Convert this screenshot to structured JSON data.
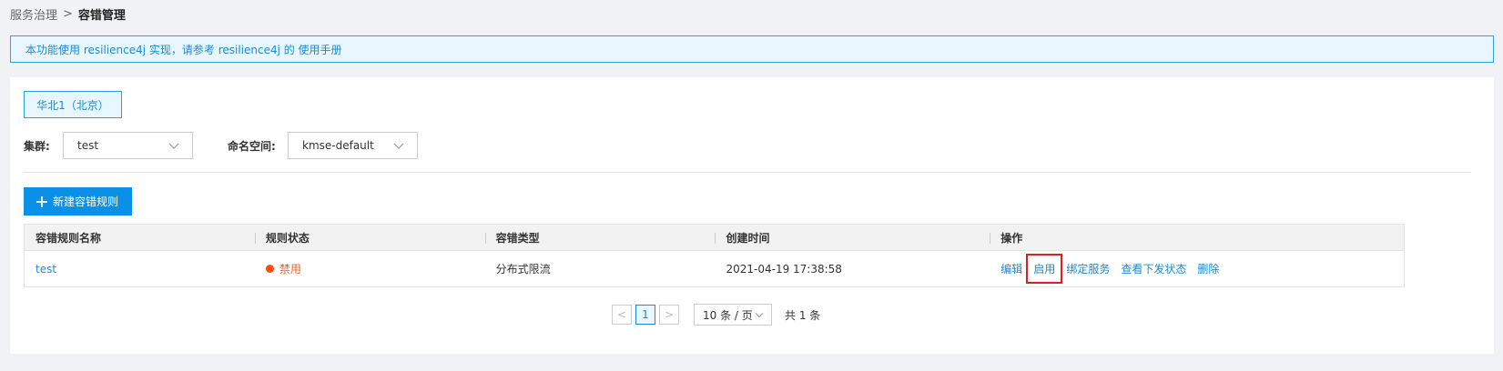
{
  "breadcrumb": {
    "parent": "服务治理",
    "separator": ">",
    "current": "容错管理"
  },
  "notice": {
    "text": "本功能使用 resilience4j 实现，请参考 resilience4j 的 使用手册"
  },
  "region": {
    "label": "华北1（北京）"
  },
  "filters": {
    "cluster_label": "集群:",
    "cluster_value": "test",
    "namespace_label": "命名空间:",
    "namespace_value": "kmse-default"
  },
  "toolbar": {
    "new_rule_label": "新建容错规则"
  },
  "table": {
    "columns": [
      "容错规则名称",
      "规则状态",
      "容错类型",
      "创建时间",
      "操作"
    ],
    "rows": [
      {
        "name": "test",
        "status": "禁用",
        "type": "分布式限流",
        "created": "2021-04-19 17:38:58",
        "actions": [
          "编辑",
          "启用",
          "绑定服务",
          "查看下发状态",
          "删除"
        ]
      }
    ]
  },
  "pagination": {
    "prev_symbol": "<",
    "current_page": "1",
    "next_symbol": ">",
    "page_size": "10 条 / 页",
    "total": "共 1 条"
  },
  "colors": {
    "accent": "#0a90e6",
    "link": "#1b8bd6",
    "status_disabled": "#ff5a1f",
    "highlight_border": "#e21e1e"
  }
}
